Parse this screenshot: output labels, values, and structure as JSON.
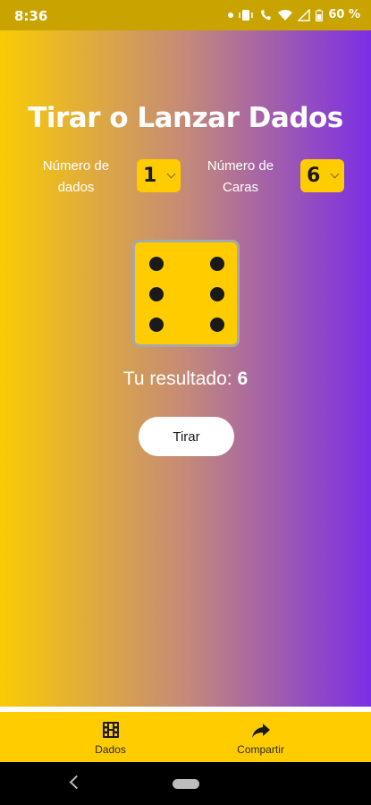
{
  "status_bar": {
    "time": "8:36",
    "battery": "60 %"
  },
  "app": {
    "title": "Tirar o Lanzar Dados",
    "dice_count": {
      "label_line1": "Número de",
      "label_line2": "dados",
      "value": "1"
    },
    "faces": {
      "label_line1": "Número de",
      "label_line2": "Caras",
      "value": "6"
    },
    "die_face": 6,
    "result": {
      "label": "Tu resultado:",
      "value": "6"
    },
    "roll_button": "Tirar"
  },
  "tabs": [
    {
      "label": "Dados",
      "icon": "film-dice-icon"
    },
    {
      "label": "Compartir",
      "icon": "share-arrow-icon"
    }
  ],
  "colors": {
    "accent": "#ffcc00",
    "gradient_start": "#f9cb05",
    "gradient_end": "#7b2ee6"
  }
}
